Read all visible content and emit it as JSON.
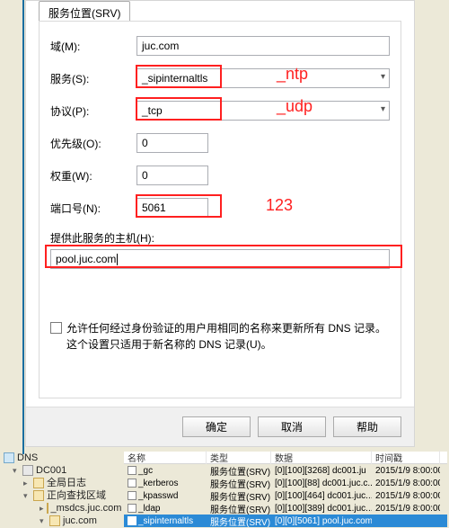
{
  "tab_label": "服务位置(SRV)",
  "labels": {
    "domain": "域(M):",
    "service": "服务(S):",
    "protocol": "协议(P):",
    "priority": "优先级(O):",
    "weight": "权重(W):",
    "port": "端口号(N):",
    "host": "提供此服务的主机(H):"
  },
  "values": {
    "domain": "juc.com",
    "service": "_sipinternaltls",
    "protocol": "_tcp",
    "priority": "0",
    "weight": "0",
    "port": "5061",
    "host": "pool.juc.com"
  },
  "annotations": {
    "service": "_ntp",
    "protocol": "_udp",
    "port": "123"
  },
  "checkbox_text": "允许任何经过身份验证的用户用相同的名称来更新所有 DNS 记录。这个设置只适用于新名称的 DNS 记录(U)。",
  "buttons": {
    "ok": "确定",
    "cancel": "取消",
    "help": "帮助"
  },
  "tree": {
    "root": "DNS",
    "server": "DC001",
    "log": "全局日志",
    "fwd": "正向查找区域",
    "msdcs": "_msdcs.juc.com",
    "juc": "juc.com"
  },
  "grid": {
    "headers": {
      "name": "名称",
      "type": "类型",
      "data": "数据",
      "time": "时间戳"
    },
    "rows": [
      {
        "name": "_gc",
        "type": "服务位置(SRV)",
        "data": "[0][100][3268] dc001.ju",
        "time": "2015/1/9 8:00:00"
      },
      {
        "name": "_kerberos",
        "type": "服务位置(SRV)",
        "data": "[0][100][88] dc001.juc.c...",
        "time": "2015/1/9 8:00:00"
      },
      {
        "name": "_kpasswd",
        "type": "服务位置(SRV)",
        "data": "[0][100][464] dc001.juc...",
        "time": "2015/1/9 8:00:00"
      },
      {
        "name": "_ldap",
        "type": "服务位置(SRV)",
        "data": "[0][100][389] dc001.juc...",
        "time": "2015/1/9 8:00:00"
      },
      {
        "name": "_sipinternaltls",
        "type": "服务位置(SRV)",
        "data": "[0][0][5061] pool.juc.com",
        "time": ""
      }
    ]
  }
}
